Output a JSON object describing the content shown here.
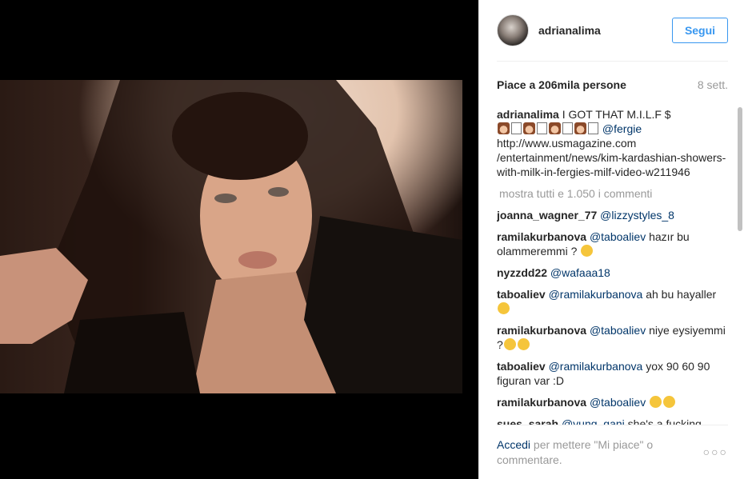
{
  "post": {
    "username": "adrianalima",
    "follow_label": "Segui",
    "likes_text": "Piace a 206mila persone",
    "age": "8 sett."
  },
  "caption": {
    "user": "adrianalima",
    "text": "I GOT THAT M.I.L.F $",
    "mention": "@fergie",
    "link": "http://www.usmagazine.com /entertainment/news/kim-kardashian-showers-with-milk-in-fergies-milf-video-w211946"
  },
  "load_more": "mostra tutti e 1.050 i commenti",
  "comments": [
    {
      "user": "joanna_wagner_77",
      "mention": "@lizzystyles_8",
      "text": ""
    },
    {
      "user": "ramilakurbanova",
      "mention": "@taboaliev",
      "text": "hazır bu olammeremmi ?"
    },
    {
      "user": "nyzzdd22",
      "mention": "@wafaaa18",
      "text": ""
    },
    {
      "user": "taboaliev",
      "mention": "@ramilakurbanova",
      "text": "ah bu hayaller"
    },
    {
      "user": "ramilakurbanova",
      "mention": "@taboaliev",
      "text": "niye eysiyemmi ?"
    },
    {
      "user": "taboaliev",
      "mention": "@ramilakurbanova",
      "text": "yox 90 60 90 figuran var :D"
    },
    {
      "user": "ramilakurbanova",
      "mention": "@taboaliev",
      "text": ""
    },
    {
      "user": "sues_sarah",
      "mention": "@yung_gani",
      "text": "she's a fucking"
    }
  ],
  "footer": {
    "login_label": "Accedi",
    "rest": "per mettere \"Mi piace\" o commentare.",
    "more_label": "○○○"
  },
  "icons": {
    "avatar": "profile-avatar",
    "more": "more-options-icon"
  }
}
